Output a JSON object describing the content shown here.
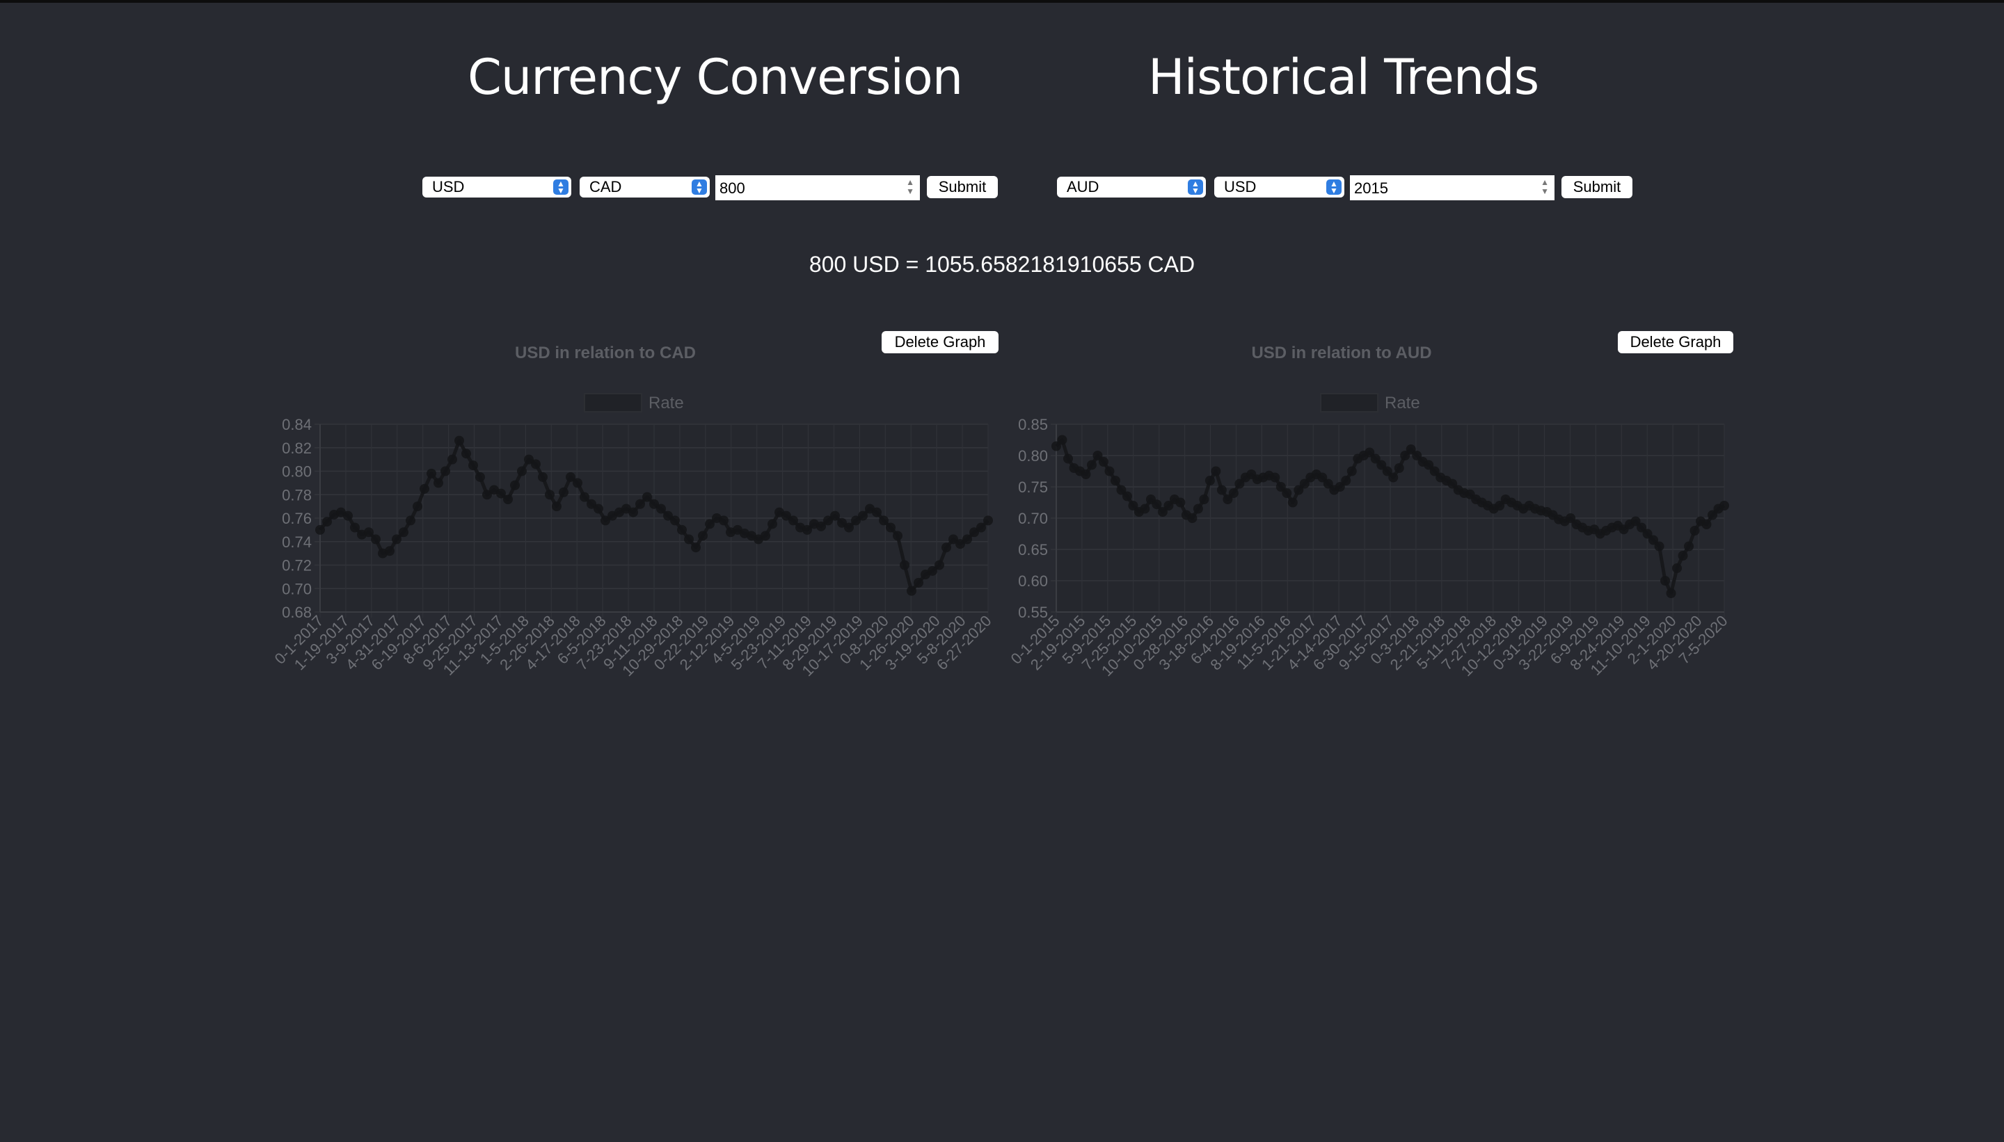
{
  "conversion": {
    "title": "Currency Conversion",
    "from_currency": "USD",
    "to_currency": "CAD",
    "amount": "800",
    "submit_label": "Submit",
    "result_text": "800 USD = 1055.6582181910655 CAD"
  },
  "historical": {
    "title": "Historical Trends",
    "from_currency": "AUD",
    "to_currency": "USD",
    "year": "2015",
    "submit_label": "Submit"
  },
  "charts": [
    {
      "delete_label": "Delete Graph"
    },
    {
      "delete_label": "Delete Graph"
    }
  ],
  "chart_data": [
    {
      "type": "line",
      "title": "USD in relation to CAD",
      "legend": "Rate",
      "legend_position": "top",
      "grid": true,
      "ylim": [
        0.68,
        0.84
      ],
      "yticks": [
        "0.84",
        "0.82",
        "0.80",
        "0.78",
        "0.76",
        "0.74",
        "0.72",
        "0.70",
        "0.68"
      ],
      "xticks": [
        "0-1-2017",
        "1-19-2017",
        "3-9-2017",
        "4-31-2017",
        "6-19-2017",
        "8-6-2017",
        "9-25-2017",
        "11-13-2017",
        "1-5-2018",
        "2-26-2018",
        "4-17-2018",
        "6-5-2018",
        "7-23-2018",
        "9-11-2018",
        "10-29-2018",
        "0-22-2019",
        "2-12-2019",
        "4-5-2019",
        "5-23-2019",
        "7-11-2019",
        "8-29-2019",
        "10-17-2019",
        "0-8-2020",
        "1-26-2020",
        "3-19-2020",
        "5-8-2020",
        "6-27-2020"
      ],
      "series": [
        {
          "values": [
            0.75,
            0.757,
            0.763,
            0.765,
            0.762,
            0.752,
            0.746,
            0.748,
            0.742,
            0.73,
            0.732,
            0.742,
            0.748,
            0.758,
            0.77,
            0.785,
            0.798,
            0.79,
            0.8,
            0.81,
            0.826,
            0.815,
            0.805,
            0.795,
            0.78,
            0.784,
            0.781,
            0.776,
            0.788,
            0.8,
            0.81,
            0.806,
            0.795,
            0.78,
            0.77,
            0.782,
            0.795,
            0.79,
            0.778,
            0.772,
            0.768,
            0.758,
            0.762,
            0.765,
            0.768,
            0.765,
            0.772,
            0.778,
            0.772,
            0.768,
            0.762,
            0.758,
            0.75,
            0.742,
            0.735,
            0.745,
            0.755,
            0.76,
            0.758,
            0.748,
            0.75,
            0.747,
            0.745,
            0.742,
            0.745,
            0.755,
            0.765,
            0.762,
            0.758,
            0.752,
            0.75,
            0.755,
            0.753,
            0.758,
            0.762,
            0.756,
            0.752,
            0.758,
            0.762,
            0.768,
            0.765,
            0.758,
            0.752,
            0.745,
            0.72,
            0.698,
            0.705,
            0.712,
            0.715,
            0.72,
            0.735,
            0.742,
            0.738,
            0.742,
            0.748,
            0.752,
            0.758
          ]
        }
      ]
    },
    {
      "type": "line",
      "title": "USD in relation to AUD",
      "legend": "Rate",
      "legend_position": "top",
      "grid": true,
      "ylim": [
        0.55,
        0.85
      ],
      "yticks": [
        "0.85",
        "0.80",
        "0.75",
        "0.70",
        "0.65",
        "0.60",
        "0.55"
      ],
      "xticks": [
        "0-1-2015",
        "2-19-2015",
        "5-9-2015",
        "7-25-2015",
        "10-10-2015",
        "0-28-2016",
        "3-18-2016",
        "6-4-2016",
        "8-19-2016",
        "11-5-2016",
        "1-21-2017",
        "4-14-2017",
        "6-30-2017",
        "9-15-2017",
        "0-3-2018",
        "2-21-2018",
        "5-11-2018",
        "7-27-2018",
        "10-12-2018",
        "0-31-2019",
        "3-22-2019",
        "6-9-2019",
        "8-24-2019",
        "11-10-2019",
        "2-1-2020",
        "4-20-2020",
        "7-5-2020"
      ],
      "series": [
        {
          "values": [
            0.815,
            0.825,
            0.795,
            0.78,
            0.775,
            0.77,
            0.785,
            0.8,
            0.79,
            0.775,
            0.76,
            0.745,
            0.735,
            0.72,
            0.71,
            0.715,
            0.73,
            0.722,
            0.71,
            0.72,
            0.73,
            0.725,
            0.705,
            0.7,
            0.715,
            0.73,
            0.76,
            0.775,
            0.745,
            0.73,
            0.74,
            0.755,
            0.765,
            0.77,
            0.762,
            0.765,
            0.768,
            0.765,
            0.75,
            0.74,
            0.725,
            0.745,
            0.755,
            0.765,
            0.77,
            0.765,
            0.755,
            0.745,
            0.75,
            0.76,
            0.775,
            0.795,
            0.8,
            0.805,
            0.795,
            0.785,
            0.775,
            0.765,
            0.78,
            0.8,
            0.81,
            0.8,
            0.79,
            0.785,
            0.775,
            0.765,
            0.76,
            0.755,
            0.745,
            0.74,
            0.738,
            0.73,
            0.725,
            0.72,
            0.715,
            0.72,
            0.73,
            0.725,
            0.72,
            0.715,
            0.72,
            0.715,
            0.712,
            0.71,
            0.705,
            0.698,
            0.695,
            0.7,
            0.69,
            0.685,
            0.68,
            0.682,
            0.675,
            0.68,
            0.685,
            0.688,
            0.682,
            0.69,
            0.695,
            0.685,
            0.675,
            0.665,
            0.655,
            0.6,
            0.58,
            0.62,
            0.64,
            0.655,
            0.68,
            0.695,
            0.69,
            0.705,
            0.715,
            0.72
          ]
        }
      ]
    }
  ]
}
